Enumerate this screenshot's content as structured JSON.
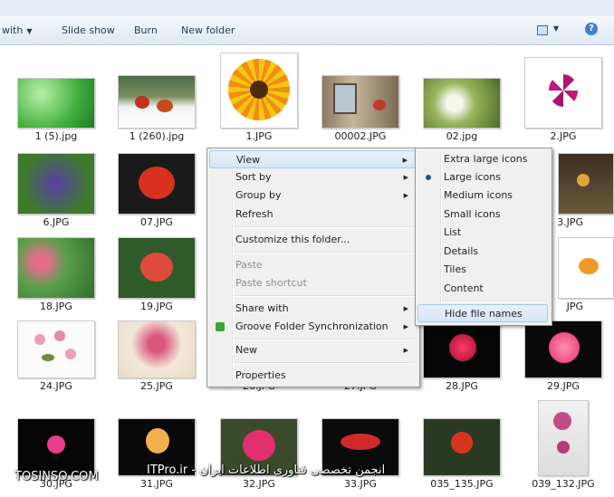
{
  "toolbar": {
    "open_with": "with",
    "slide_show": "Slide show",
    "burn": "Burn",
    "new_folder": "New folder",
    "help": "?"
  },
  "files": [
    {
      "name": "1 (5).jpg"
    },
    {
      "name": "1 (260).jpg"
    },
    {
      "name": "1.JPG"
    },
    {
      "name": "00002.JPG"
    },
    {
      "name": "02.jpg"
    },
    {
      "name": "2.JPG"
    },
    {
      "name": "6.JPG"
    },
    {
      "name": "07.JPG"
    },
    {
      "name": "3.JPG"
    },
    {
      "name": "18.JPG"
    },
    {
      "name": "19.JPG"
    },
    {
      "name": "JPG"
    },
    {
      "name": "24.JPG"
    },
    {
      "name": "25.JPG"
    },
    {
      "name": "26.JPG"
    },
    {
      "name": "27.JPG"
    },
    {
      "name": "28.JPG"
    },
    {
      "name": "29.JPG"
    },
    {
      "name": "30.JPG"
    },
    {
      "name": "31.JPG"
    },
    {
      "name": "32.JPG"
    },
    {
      "name": "33.JPG"
    },
    {
      "name": "035_135.JPG"
    },
    {
      "name": "039_132.JPG"
    }
  ],
  "context_menu": {
    "view": "View",
    "sort_by": "Sort by",
    "group_by": "Group by",
    "refresh": "Refresh",
    "customize": "Customize this folder...",
    "paste": "Paste",
    "paste_shortcut": "Paste shortcut",
    "share_with": "Share with",
    "groove": "Groove Folder Synchronization",
    "new": "New",
    "properties": "Properties"
  },
  "view_submenu": {
    "items": [
      "Extra large icons",
      "Large icons",
      "Medium icons",
      "Small icons",
      "List",
      "Details",
      "Tiles",
      "Content"
    ],
    "selected": "Large icons",
    "hide_file_names": "Hide file names"
  },
  "watermark": {
    "left": "TOSINSO.COM",
    "right": "ITPro.ir - انجمن تخصصی فناوری اطلاعات ایران"
  }
}
